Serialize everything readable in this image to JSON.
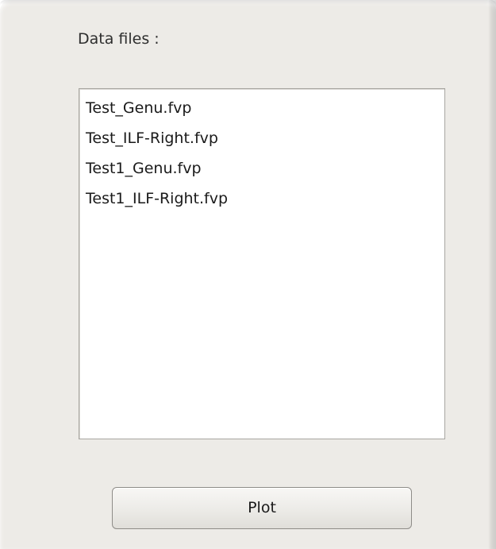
{
  "panel": {
    "label": "Data files :"
  },
  "files": [
    {
      "label": "Test_Genu.fvp"
    },
    {
      "label": "Test_ILF-Right.fvp"
    },
    {
      "label": "Test1_Genu.fvp"
    },
    {
      "label": "Test1_ILF-Right.fvp"
    }
  ],
  "actions": {
    "plot_label": "Plot"
  }
}
